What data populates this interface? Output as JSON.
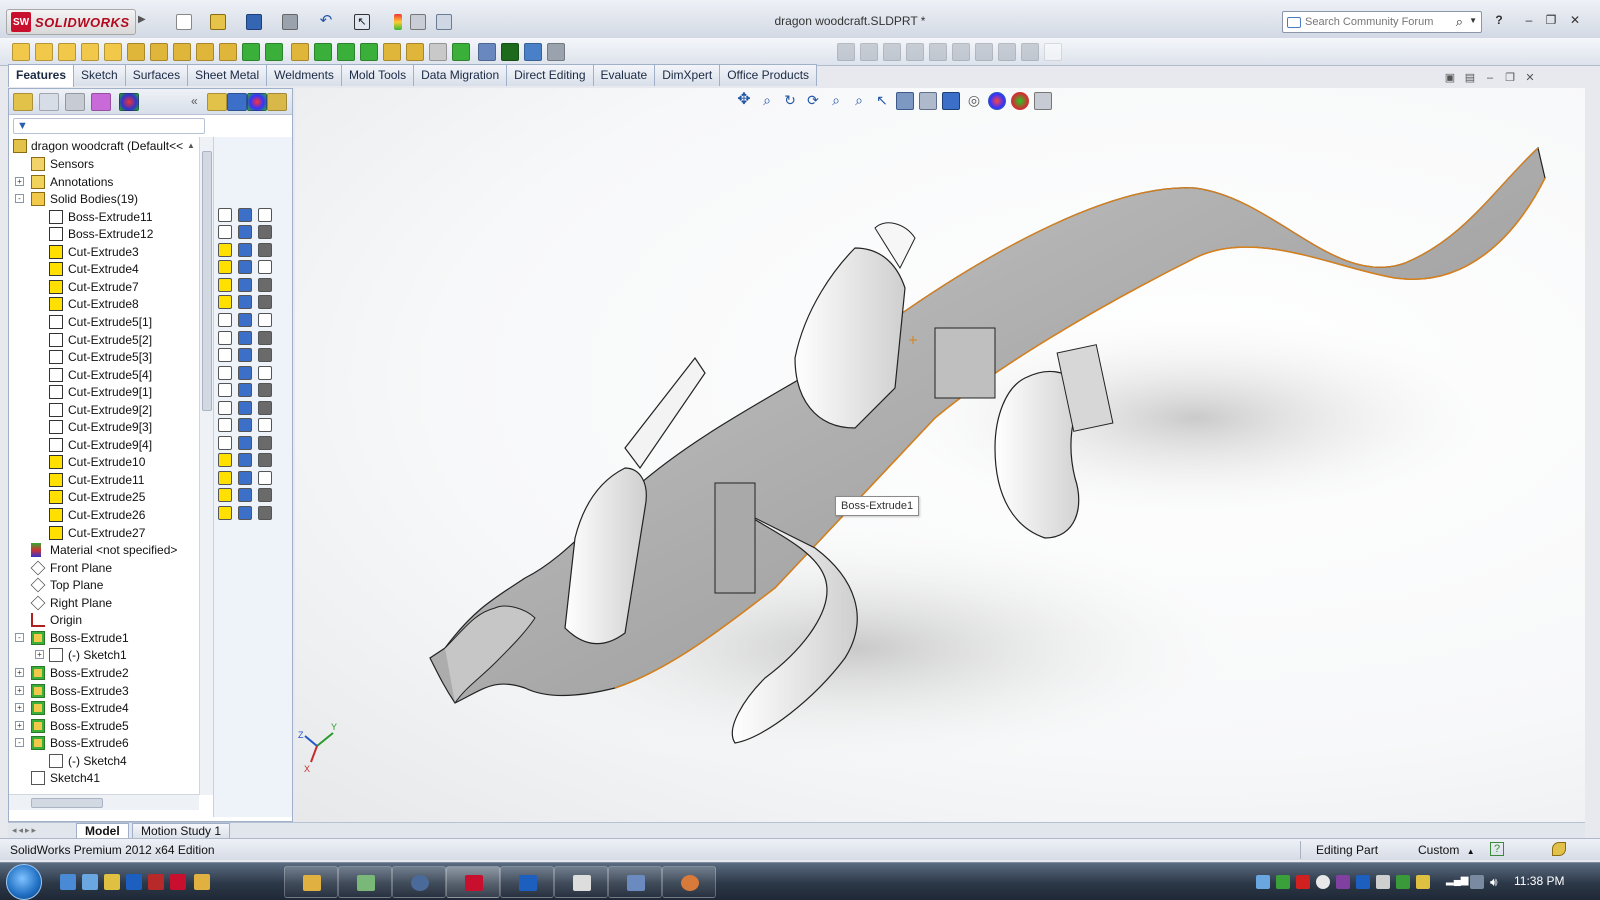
{
  "app": {
    "brand": "SOLIDWORKS",
    "brand_badge": "SW",
    "document_title": "dragon woodcraft.SLDPRT *"
  },
  "search": {
    "placeholder": "Search Community Forum"
  },
  "command_tabs": [
    "Features",
    "Sketch",
    "Surfaces",
    "Sheet Metal",
    "Weldments",
    "Mold Tools",
    "Data Migration",
    "Direct Editing",
    "Evaluate",
    "DimXpert",
    "Office Products"
  ],
  "active_command_tab": "Features",
  "feature_tree": {
    "root_label": "dragon woodcraft  (Default<<",
    "rows": [
      {
        "label": "Sensors",
        "icon": "sensors-icon",
        "indent": 0,
        "expander": ""
      },
      {
        "label": "Annotations",
        "icon": "annotations-icon",
        "indent": 0,
        "expander": "+"
      },
      {
        "label": "Solid Bodies(19)",
        "icon": "solid-bodies-folder-icon",
        "indent": 0,
        "expander": "-"
      },
      {
        "label": "Boss-Extrude11",
        "icon": "body-icon",
        "indent": 1,
        "expander": ""
      },
      {
        "label": "Boss-Extrude12",
        "icon": "body-icon",
        "indent": 1,
        "expander": ""
      },
      {
        "label": "Cut-Extrude3",
        "icon": "body-yellow-icon",
        "indent": 1,
        "expander": ""
      },
      {
        "label": "Cut-Extrude4",
        "icon": "body-yellow-icon",
        "indent": 1,
        "expander": ""
      },
      {
        "label": "Cut-Extrude7",
        "icon": "body-yellow-icon",
        "indent": 1,
        "expander": ""
      },
      {
        "label": "Cut-Extrude8",
        "icon": "body-yellow-icon",
        "indent": 1,
        "expander": ""
      },
      {
        "label": "Cut-Extrude5[1]",
        "icon": "body-icon",
        "indent": 1,
        "expander": ""
      },
      {
        "label": "Cut-Extrude5[2]",
        "icon": "body-icon",
        "indent": 1,
        "expander": ""
      },
      {
        "label": "Cut-Extrude5[3]",
        "icon": "body-icon",
        "indent": 1,
        "expander": ""
      },
      {
        "label": "Cut-Extrude5[4]",
        "icon": "body-icon",
        "indent": 1,
        "expander": ""
      },
      {
        "label": "Cut-Extrude9[1]",
        "icon": "body-icon",
        "indent": 1,
        "expander": ""
      },
      {
        "label": "Cut-Extrude9[2]",
        "icon": "body-icon",
        "indent": 1,
        "expander": ""
      },
      {
        "label": "Cut-Extrude9[3]",
        "icon": "body-icon",
        "indent": 1,
        "expander": ""
      },
      {
        "label": "Cut-Extrude9[4]",
        "icon": "body-icon",
        "indent": 1,
        "expander": ""
      },
      {
        "label": "Cut-Extrude10",
        "icon": "body-yellow-icon",
        "indent": 1,
        "expander": ""
      },
      {
        "label": "Cut-Extrude11",
        "icon": "body-yellow-icon",
        "indent": 1,
        "expander": ""
      },
      {
        "label": "Cut-Extrude25",
        "icon": "body-yellow-icon",
        "indent": 1,
        "expander": ""
      },
      {
        "label": "Cut-Extrude26",
        "icon": "body-yellow-icon",
        "indent": 1,
        "expander": ""
      },
      {
        "label": "Cut-Extrude27",
        "icon": "body-yellow-icon",
        "indent": 1,
        "expander": ""
      },
      {
        "label": "Material <not specified>",
        "icon": "material-icon",
        "indent": 0,
        "expander": ""
      },
      {
        "label": "Front Plane",
        "icon": "plane-icon",
        "indent": 0,
        "expander": ""
      },
      {
        "label": "Top Plane",
        "icon": "plane-icon",
        "indent": 0,
        "expander": ""
      },
      {
        "label": "Right Plane",
        "icon": "plane-icon",
        "indent": 0,
        "expander": ""
      },
      {
        "label": "Origin",
        "icon": "origin-icon",
        "indent": 0,
        "expander": ""
      },
      {
        "label": "Boss-Extrude1",
        "icon": "boss-extrude-icon",
        "indent": 0,
        "expander": "-"
      },
      {
        "label": "(-) Sketch1",
        "icon": "sketch-icon",
        "indent": 1,
        "expander": "+"
      },
      {
        "label": "Boss-Extrude2",
        "icon": "boss-extrude-icon",
        "indent": 0,
        "expander": "+"
      },
      {
        "label": "Boss-Extrude3",
        "icon": "boss-extrude-icon",
        "indent": 0,
        "expander": "+"
      },
      {
        "label": "Boss-Extrude4",
        "icon": "boss-extrude-icon",
        "indent": 0,
        "expander": "+"
      },
      {
        "label": "Boss-Extrude5",
        "icon": "boss-extrude-icon",
        "indent": 0,
        "expander": "+"
      },
      {
        "label": "Boss-Extrude6",
        "icon": "boss-extrude-icon",
        "indent": 0,
        "expander": "-"
      },
      {
        "label": "(-) Sketch4",
        "icon": "sketch-icon",
        "indent": 1,
        "expander": ""
      },
      {
        "label": "Sketch41",
        "icon": "sketch-icon",
        "indent": 0,
        "expander": ""
      }
    ]
  },
  "viewport": {
    "tooltip": "Boss-Extrude1",
    "triad_axes": [
      "X",
      "Y",
      "Z"
    ]
  },
  "model_tabs": [
    "Model",
    "Motion Study 1"
  ],
  "status": {
    "edition": "SolidWorks Premium 2012 x64 Edition",
    "mode": "Editing Part",
    "units": "Custom"
  },
  "taskbar": {
    "clock": "11:38 PM"
  },
  "colors": {
    "accent": "#2a5fb0",
    "sw_red": "#c8102e",
    "model_gray": "#9b9b9b",
    "edge_orange": "#d8801a"
  }
}
